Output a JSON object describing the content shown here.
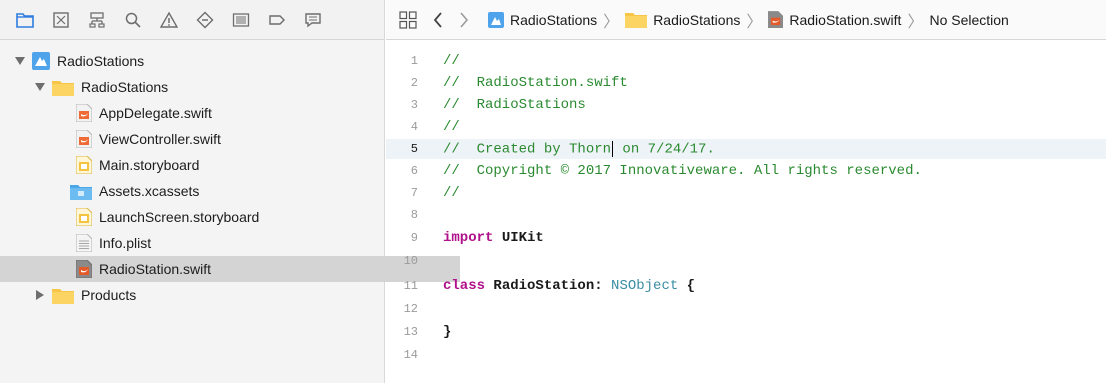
{
  "navigator": {
    "toolbar_icons": [
      "folder-icon",
      "source-control-icon",
      "symbol-icon",
      "search-icon",
      "warning-icon",
      "test-icon",
      "debug-icon",
      "breakpoint-icon",
      "report-icon"
    ],
    "tree": [
      {
        "label": "RadioStations",
        "kind": "project",
        "expanded": true,
        "depth": 0
      },
      {
        "label": "RadioStations",
        "kind": "folder",
        "expanded": true,
        "depth": 1
      },
      {
        "label": "AppDelegate.swift",
        "kind": "swift",
        "depth": 2
      },
      {
        "label": "ViewController.swift",
        "kind": "swift",
        "depth": 2
      },
      {
        "label": "Main.storyboard",
        "kind": "storyboard",
        "depth": 2
      },
      {
        "label": "Assets.xcassets",
        "kind": "assets",
        "depth": 2
      },
      {
        "label": "LaunchScreen.storyboard",
        "kind": "storyboard",
        "depth": 2
      },
      {
        "label": "Info.plist",
        "kind": "plist",
        "depth": 2
      },
      {
        "label": "RadioStation.swift",
        "kind": "swift",
        "depth": 2,
        "selected": true
      },
      {
        "label": "Products",
        "kind": "folder",
        "expanded": false,
        "depth": 1
      }
    ]
  },
  "jumpbar": {
    "crumbs": [
      "RadioStations",
      "RadioStations",
      "RadioStation.swift",
      "No Selection"
    ]
  },
  "editor": {
    "current_line": 5,
    "lines": [
      {
        "n": "1",
        "text": "//",
        "style": "cmt"
      },
      {
        "n": "2",
        "text": "//  RadioStation.swift",
        "style": "cmt"
      },
      {
        "n": "3",
        "text": "//  RadioStations",
        "style": "cmt"
      },
      {
        "n": "4",
        "text": "//",
        "style": "cmt"
      },
      {
        "n": "5",
        "text_before": "//  Created by Thorn",
        "text_after": " on 7/24/17.",
        "style": "cmt"
      },
      {
        "n": "6",
        "text": "//  Copyright © 2017 Innovativeware. All rights reserved.",
        "style": "cmt"
      },
      {
        "n": "7",
        "text": "//",
        "style": "cmt"
      },
      {
        "n": "8",
        "text": "",
        "style": "plain"
      },
      {
        "n": "9",
        "kw": "import",
        "rest": " UIKit",
        "style": "kw"
      },
      {
        "n": "10",
        "text": "",
        "style": "plain"
      },
      {
        "n": "11",
        "kw": "class",
        "mid": " RadioStation: ",
        "type": "NSObject",
        "end": " {",
        "style": "class"
      },
      {
        "n": "12",
        "text": "",
        "style": "plain"
      },
      {
        "n": "13",
        "text": "}",
        "style": "plain"
      },
      {
        "n": "14",
        "text": "",
        "style": "plain"
      }
    ]
  },
  "colors": {
    "comment": "#2a8a30",
    "keyword": "#b0108a",
    "type": "#3a8da3",
    "folder": "#f7c548",
    "selection": "#d4d4d4"
  }
}
